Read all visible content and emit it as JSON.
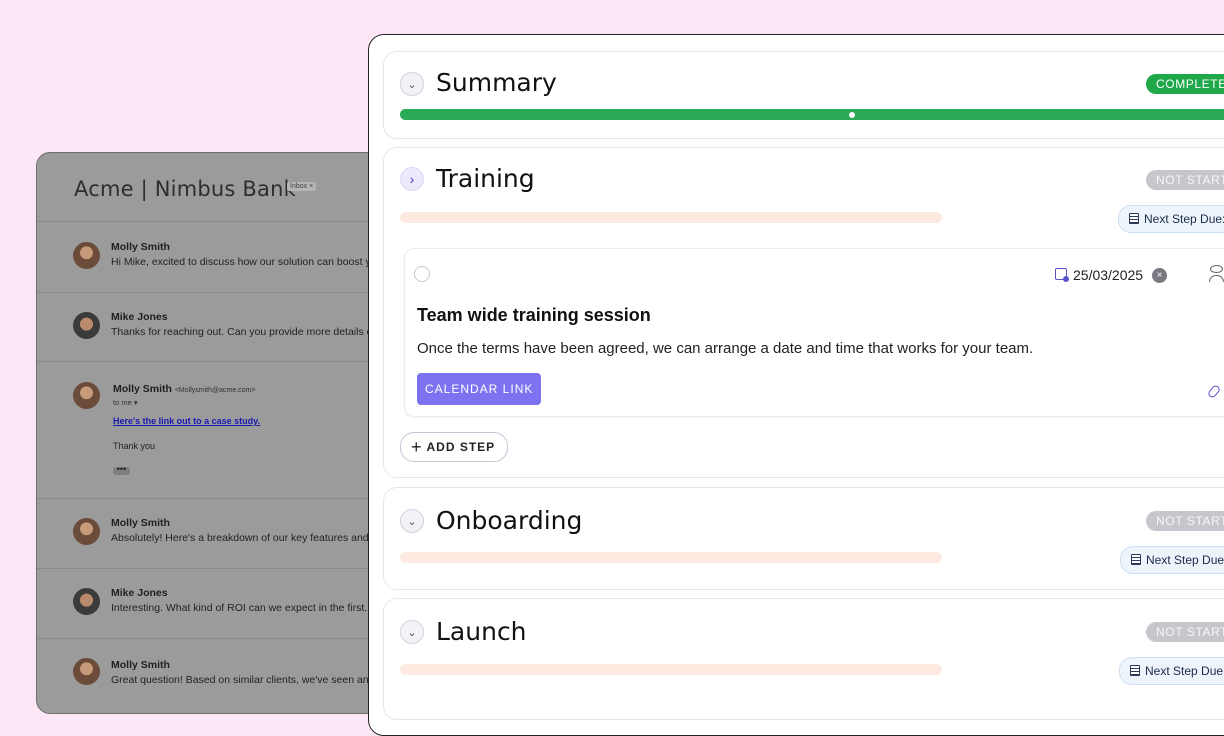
{
  "email": {
    "title": "Acme | Nimbus Bank",
    "inbox_label": "Inbox ×",
    "messages": [
      {
        "sender": "Molly Smith",
        "snippet": "Hi Mike, excited to discuss how our solution can boost y"
      },
      {
        "sender": "Mike Jones",
        "snippet": "Thanks for reaching out. Can you provide more details o"
      },
      {
        "sender": "Molly Smith",
        "address": "<Mollysmith@acme.com>",
        "to_me": "to me ▾",
        "link": "Here's the link out to a case study.",
        "thanks": "Thank you",
        "more": "•••"
      },
      {
        "sender": "Molly Smith",
        "snippet": "Absolutely! Here's a breakdown of our key features and"
      },
      {
        "sender": "Mike Jones",
        "snippet": "Interesting. What kind of ROI can we expect in the first..."
      },
      {
        "sender": "Molly Smith",
        "snippet": "Great question! Based on similar clients, we've seen an"
      }
    ]
  },
  "sections": [
    {
      "title": "Summary",
      "status": "COMPLETE",
      "progress": 1.0
    },
    {
      "title": "Training",
      "status": "NOT STARTE",
      "progress": 0.0,
      "next_due": "Next Step Due:"
    },
    {
      "title": "Onboarding",
      "status": "NOT STARTE",
      "progress": 0.0,
      "next_due": "Next Step Due:"
    },
    {
      "title": "Launch",
      "status": "NOT STARTE",
      "progress": 0.0,
      "next_due": "Next Step Due:"
    }
  ],
  "step": {
    "due_date": "25/03/2025",
    "clear": "×",
    "title": "Team wide training session",
    "description": "Once the terms have been agreed, we can arrange a date and time that works for your team.",
    "button": "CALENDAR LINK"
  },
  "add_step": {
    "plus": "+",
    "label": "ADD STEP"
  },
  "icons": {
    "collapse": "chevron-down-icon",
    "expand": "chevron-right-icon"
  },
  "colors": {
    "complete": "#1fa84a",
    "accent": "#7d73f0",
    "not_started": "#c8c6cc",
    "background": "#fde7f6"
  }
}
